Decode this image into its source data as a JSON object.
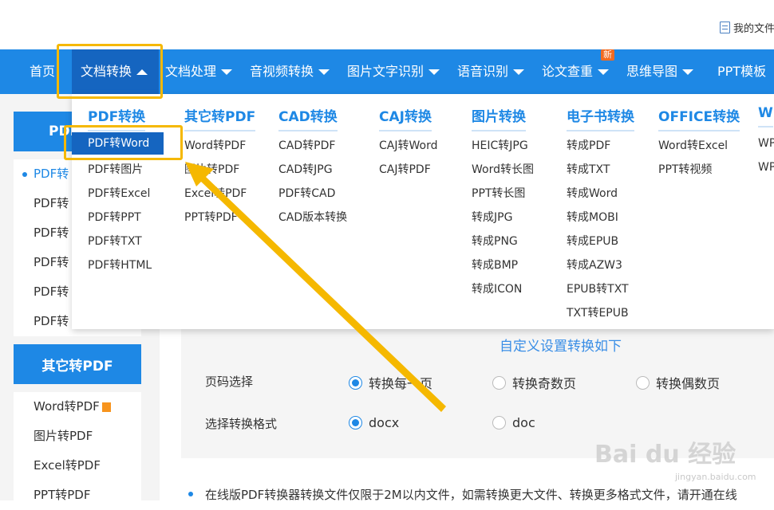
{
  "topbar": {
    "my_files": "我的文件"
  },
  "nav": {
    "items": [
      {
        "label": "首页"
      },
      {
        "label": "文档转换"
      },
      {
        "label": "文档处理"
      },
      {
        "label": "音视频转换"
      },
      {
        "label": "图片文字识别"
      },
      {
        "label": "语音识别"
      },
      {
        "label": "论文查重"
      },
      {
        "label": "思维导图"
      },
      {
        "label": "PPT模板"
      }
    ],
    "new_badge": "新"
  },
  "sidebar": {
    "section1_head": "PDF",
    "section1_items": [
      "PDF转",
      "PDF转",
      "PDF转",
      "PDF转",
      "PDF转",
      "PDF转"
    ],
    "section2_head": "其它转PDF",
    "section2_items": [
      "Word转PDF",
      "图片转PDF",
      "Excel转PDF",
      "PPT转PDF"
    ]
  },
  "dropdown": {
    "columns": [
      {
        "head": "PDF转换",
        "items": [
          "PDF转Word",
          "PDF转图片",
          "PDF转Excel",
          "PDF转PPT",
          "PDF转TXT",
          "PDF转HTML"
        ]
      },
      {
        "head": "其它转PDF",
        "items": [
          "Word转PDF",
          "图片转PDF",
          "Excel转PDF",
          "PPT转PDF"
        ]
      },
      {
        "head": "CAD转换",
        "items": [
          "CAD转PDF",
          "CAD转JPG",
          "PDF转CAD",
          "CAD版本转换"
        ]
      },
      {
        "head": "CAJ转换",
        "items": [
          "CAJ转Word",
          "CAJ转PDF"
        ]
      },
      {
        "head": "图片转换",
        "items": [
          "HEIC转JPG",
          "Word转长图",
          "PPT转长图",
          "转成JPG",
          "转成PNG",
          "转成BMP",
          "转成ICON"
        ]
      },
      {
        "head": "电子书转换",
        "items": [
          "转成PDF",
          "转成TXT",
          "转成Word",
          "转成MOBI",
          "转成EPUB",
          "转成AZW3",
          "EPUB转TXT",
          "TXT转EPUB"
        ]
      },
      {
        "head": "OFFICE转换",
        "items": [
          "Word转Excel",
          "PPT转视频"
        ]
      },
      {
        "head": "W",
        "items": [
          "WP",
          "WP"
        ]
      }
    ]
  },
  "main": {
    "custom_title": "自定义设置转换如下",
    "page_label": "页码选择",
    "page_options": [
      "转换每一页",
      "转换奇数页",
      "转换偶数页"
    ],
    "format_label": "选择转换格式",
    "format_options": [
      "docx",
      "doc"
    ],
    "note": "在线版PDF转换器转换文件仅限于2M以内文件，如需转换更大文件、转换更多格式文件，请开通在线"
  },
  "watermark": {
    "text": "Bai du 经验",
    "sub": "jingyan.baidu.com"
  },
  "colors": {
    "nav_bg": "#1e88e5",
    "highlight": "#f5b800",
    "accent": "#1e88e5"
  }
}
